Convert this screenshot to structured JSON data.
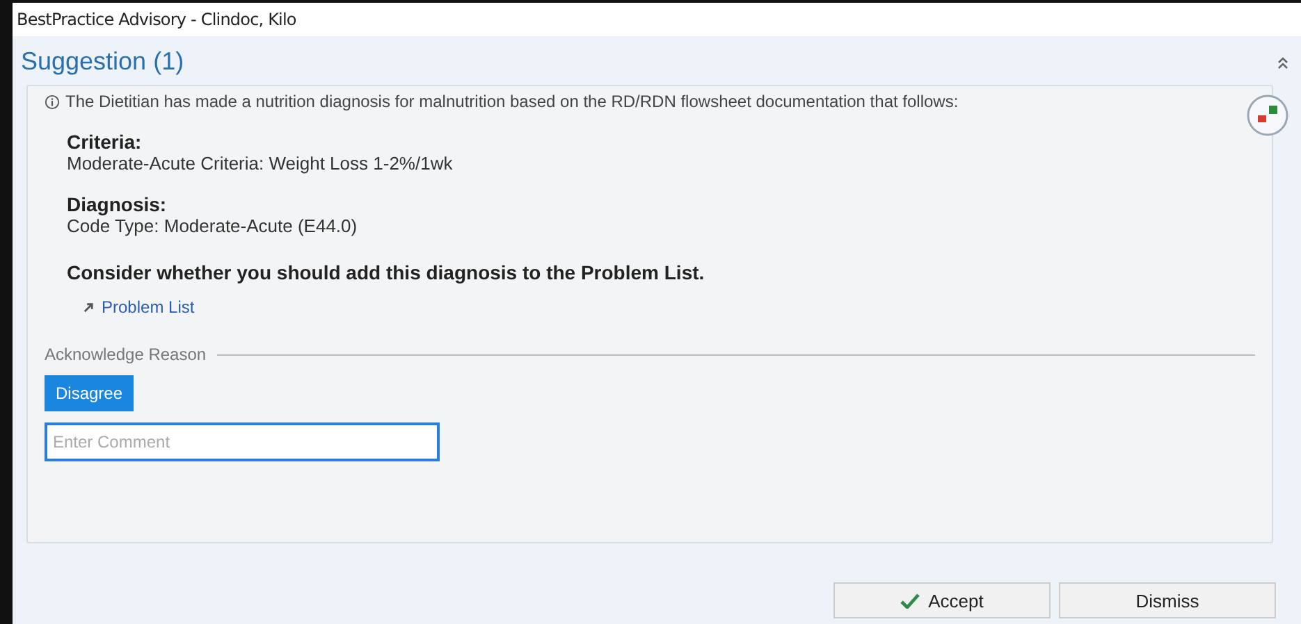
{
  "window": {
    "title": "BestPractice Advisory - Clindoc, Kilo"
  },
  "section": {
    "title": "Suggestion (1)",
    "expanded": true
  },
  "advisory": {
    "message": "The Dietitian has made a nutrition diagnosis for malnutrition based on the RD/RDN flowsheet documentation that follows:",
    "blocks": [
      {
        "heading": "Criteria:",
        "text": "Moderate-Acute Criteria: Weight Loss 1-2%/1wk"
      },
      {
        "heading": "Diagnosis:",
        "text": "Code Type: Moderate-Acute (E44.0)"
      }
    ],
    "prompt": "Consider whether you should add this diagnosis to the Problem List.",
    "link": "Problem List",
    "acknowledge": {
      "label": "Acknowledge Reason",
      "options": [
        {
          "label": "Disagree",
          "selected": true
        }
      ],
      "comment": {
        "placeholder": "Enter Comment"
      }
    }
  },
  "buttons": [
    {
      "label": "Accept",
      "kind": "accept"
    },
    {
      "label": "Dismiss",
      "kind": "plain"
    }
  ]
}
